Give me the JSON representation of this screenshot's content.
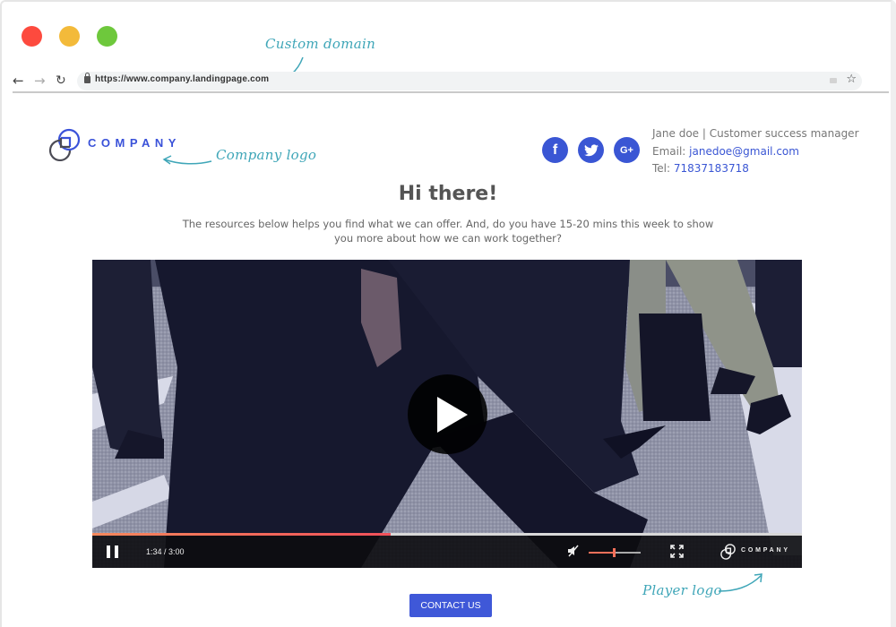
{
  "window": {
    "traffic_lights": [
      "close",
      "minimize",
      "maximize"
    ],
    "colors": {
      "close": "#fd4a3e",
      "minimize": "#f3ba3a",
      "maximize": "#6ec83c"
    }
  },
  "browser": {
    "url": "https://www.company.landingpage.com",
    "nav_icons": [
      "back-arrow-icon",
      "forward-arrow-icon",
      "reload-icon"
    ],
    "omnibox_icons": [
      "lock-icon",
      "extension-icon",
      "star-icon"
    ]
  },
  "annotations": {
    "custom_domain": "Custom domain",
    "company_logo": "Company logo",
    "player_logo": "Player logo"
  },
  "header": {
    "logo_text": "COMPANY",
    "social": [
      {
        "name": "facebook",
        "glyph": "f"
      },
      {
        "name": "twitter",
        "glyph": "🐦"
      },
      {
        "name": "google-plus",
        "glyph": "G+"
      }
    ],
    "contact": {
      "name_title": "Jane doe | Customer success manager",
      "email_label": "Email: ",
      "email": "janedoe@gmail.com",
      "tel_label": "Tel: ",
      "tel": "71837183718"
    }
  },
  "main": {
    "headline": "Hi there!",
    "subtext": "The resources below helps you find what we can offer. And, do you have 15-20 mins this week to show you more about how we can work together?"
  },
  "video": {
    "state": "paused",
    "current_time": "1:34",
    "duration": "3:00",
    "time_display": "1:34 / 3:00",
    "progress_fraction": 0.42,
    "volume_fraction": 0.48,
    "muted": true,
    "player_logo_text": "COMPANY",
    "accent_color": "#f0505a"
  },
  "cta": {
    "label": "CONTACT US",
    "color": "#3f58d8"
  }
}
